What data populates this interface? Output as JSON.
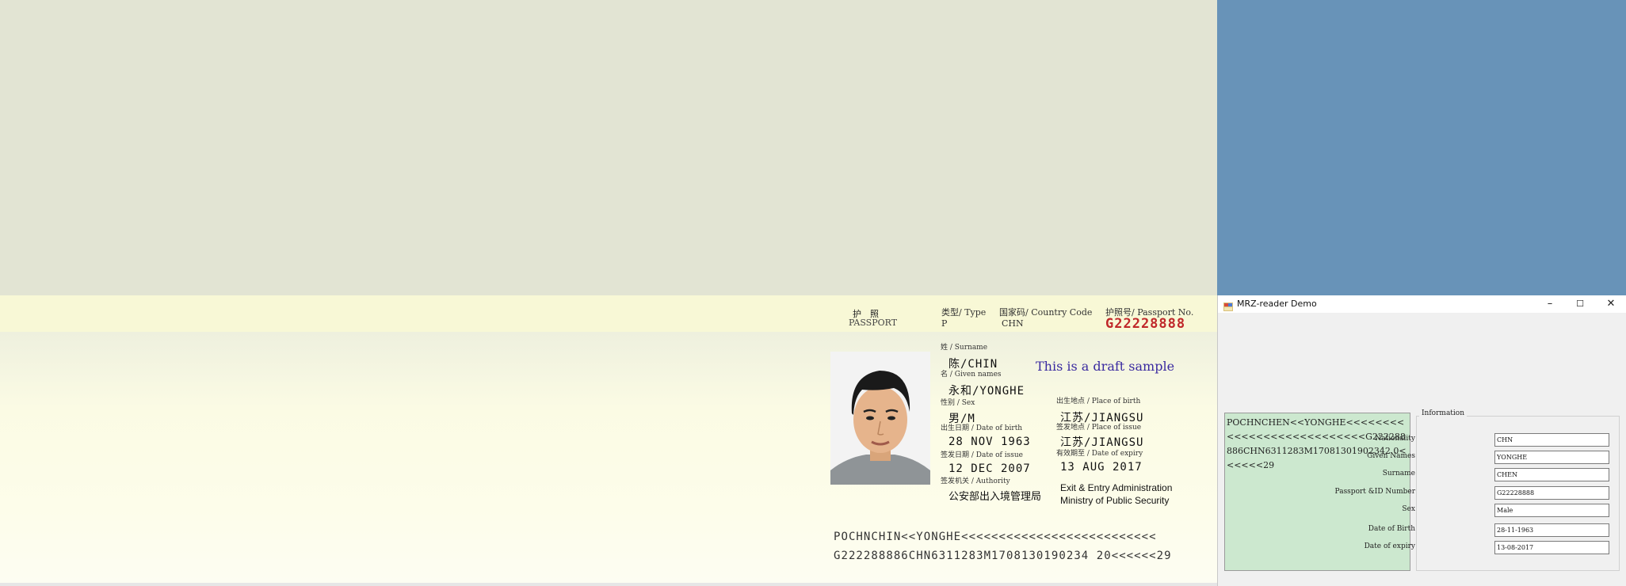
{
  "passport": {
    "title_cn": "护　照",
    "title_en": "PASSPORT",
    "type_label": "类型/ Type",
    "type_value": "P",
    "country_label": "国家码/ Country Code",
    "country_value": "CHN",
    "passno_label": "护照号/ Passport No.",
    "passno_value": "G22228888",
    "surname_label": "姓 / Surname",
    "surname_value": "陈/CHIN",
    "given_label": "名 / Given names",
    "given_value": "永和/YONGHE",
    "sex_label": "性别 / Sex",
    "sex_value": "男/M",
    "pob_label": "出生地点 / Place of birth",
    "pob_value": "江苏/JIANGSU",
    "dob_label": "出生日期 / Date of birth",
    "dob_value": "28 NOV 1963",
    "poi_label": "签发地点 / Place of issue",
    "poi_value": "江苏/JIANGSU",
    "doi_label": "签发日期 / Date of issue",
    "doi_value": "12 DEC 2007",
    "doe_label": "有效期至 / Date of expiry",
    "doe_value": "13 AUG 2017",
    "authority_label": "签发机关 / Authority",
    "authority_cn": "公安部出入境管理局",
    "authority_en1": "Exit & Entry Administration",
    "authority_en2": "Ministry of Public Security",
    "draft_note": "This is a draft sample",
    "mrz_line1": "POCHNCHIN<<YONGHE<<<<<<<<<<<<<<<<<<<<<<<<<<",
    "mrz_line2": "G222288886CHN6311283M1708130190234 20<<<<<<29"
  },
  "window": {
    "title": "MRZ-reader Demo",
    "minimize": "–",
    "maximize": "☐",
    "close": "✕",
    "mrz_text": "POCHNCHEN<<YONGHE<<<<<<<<<<<<<<<<<<<<<<<<<<<G222288886CHN6311283M17081301902342 0<<<<<<29",
    "group_title": "Information",
    "fields": [
      {
        "label": "Nationality",
        "value": "CHN"
      },
      {
        "label": "Given Names",
        "value": "YONGHE"
      },
      {
        "label": "Surname",
        "value": "CHEN"
      },
      {
        "label": "Passport &ID Number",
        "value": "G22228888"
      },
      {
        "label": "Sex",
        "value": "Male"
      },
      {
        "label": "Date of Birth",
        "value": "28-11-1963"
      },
      {
        "label": "Date of expiry",
        "value": "13-08-2017"
      }
    ]
  }
}
